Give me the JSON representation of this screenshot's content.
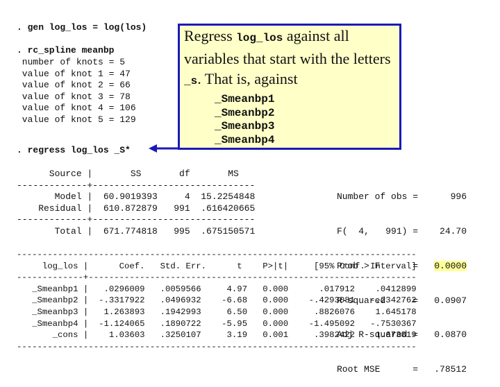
{
  "commands": {
    "gen": ". gen log_los = log(los)",
    "rc_spline": ". rc_spline meanbp",
    "regress": ". regress log_los _S*"
  },
  "spline_output": [
    " number of knots = 5",
    " value of knot 1 = 47",
    " value of knot 2 = 66",
    " value of knot 3 = 78",
    " value of knot 4 = 106",
    " value of knot 5 = 129"
  ],
  "callout": {
    "line1_pre": "Regress ",
    "line1_code": "log_los",
    "line1_post": " against all",
    "line2": "variables that start with the letters",
    "line3_code": "_s",
    "line3_post": ".  That is, against",
    "vars": [
      "_Smeanbp1",
      "_Smeanbp2",
      "_Smeanbp3",
      "_Smeanbp4"
    ],
    "border_color": "#1a1ab8",
    "fill_color": "#ffffc8"
  },
  "anova": {
    "header": "      Source |       SS       df       MS",
    "sep": "-------------+------------------------------",
    "rows": [
      "       Model |  60.9019393     4  15.2254848",
      "    Residual |  610.872879   991  .616420665"
    ],
    "sep2": "-------------+------------------------------",
    "total": "       Total |  671.774818   995  .675150571"
  },
  "stats": [
    {
      "label": "Number of obs =",
      "value": "996"
    },
    {
      "label": "F(  4,   991) =",
      "value": "24.70"
    },
    {
      "label": "Prob > F      =",
      "value": "0.0000",
      "highlight": true
    },
    {
      "label": "R-squared     =",
      "value": "0.0907"
    },
    {
      "label": "Adj R-squared =",
      "value": "0.0870"
    },
    {
      "label": "Root MSE      =",
      "value": ".78512"
    }
  ],
  "coef_table": {
    "top_rule": "------------------------------------------------------------------------------",
    "header": "     log_los |      Coef.   Std. Err.      t    P>|t|     [95% Conf. Interval]",
    "mid_rule": "-------------+----------------------------------------------------------------",
    "rows": [
      "   _Smeanbp1 |   .0296009   .0059566     4.97   0.000      .017912    .0412899",
      "   _Smeanbp2 |  -.3317922   .0496932    -6.68   0.000    -.4293081   -.2342762",
      "   _Smeanbp3 |   1.263893   .1942993     6.50   0.000     .8826076    1.645178",
      "   _Smeanbp4 |  -1.124065   .1890722    -5.95   0.000    -1.495092   -.7530367",
      "       _cons |    1.03603   .3250107     3.19   0.001     .3982422    1.673819"
    ],
    "bottom_rule": "------------------------------------------------------------------------------"
  },
  "highlight_color": "#ffff99"
}
